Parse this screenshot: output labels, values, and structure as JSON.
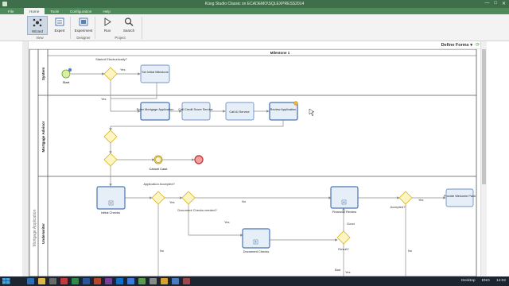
{
  "window": {
    "title": "Kūog Studio Classic on ECADEMO\\SQLEXPRESS2014",
    "minimize": "—",
    "maximize": "□",
    "close": "✕"
  },
  "ribbon_tabs": [
    "File",
    "Home",
    "Tools",
    "Configuration",
    "Help"
  ],
  "ribbon": {
    "buttons": [
      {
        "label": "Wizard",
        "icon": "wizard-icon"
      },
      {
        "label": "Expert",
        "icon": "expert-icon"
      },
      {
        "label": "Experiment",
        "icon": "experiment-icon"
      },
      {
        "label": "Run",
        "icon": "run-icon"
      },
      {
        "label": "Search",
        "icon": "search-icon"
      }
    ],
    "groups": [
      "View",
      "Designer",
      "Project"
    ]
  },
  "header": {
    "define_forms": "Define Forms ▾"
  },
  "diagram": {
    "milestone": "Milestone 1",
    "pool": "Mortgage Application",
    "lanes": [
      "System",
      "Mortgage Advisor",
      "Underwriter"
    ],
    "start": "Start",
    "gateways": {
      "started_electronically": "Started Electronically?",
      "application_accepted": "Application Accepted?",
      "document_checks_needed": "Document Checks needed?",
      "accepted": "Accepted?",
      "result": "Result?"
    },
    "tasks": {
      "set_initial_milestone": "Set Initial Milestone",
      "enter_mortgage_application": "Enter Mortgage Application",
      "call_credit_score": "Call Credit Score Service",
      "call_ai_service": "Call AI Service",
      "review_application": "Review Application",
      "provide_welcome_pack": "Provide Welcome Pack"
    },
    "subprocesses": {
      "initial_checks": "Initial Checks",
      "financial_review": "Financial Review",
      "document_checks": "Document Checks"
    },
    "events": {
      "cancel_case": "Cancel Case"
    },
    "flow_labels": {
      "yes_top": "Yes",
      "yes_left": "Yes",
      "yes_app": "Yes",
      "no_app": "No",
      "yes_docs": "Yes",
      "no_docs": "No",
      "yes_accepted": "Yes",
      "no_accepted": "No",
      "good": "Good",
      "bad": "Bad",
      "yes_bottom": "Yes"
    }
  },
  "taskbar": {
    "desktop": "Desktop",
    "lang": "ENG",
    "time": "14:02"
  },
  "colors": {
    "title_green": "#3f6f4a",
    "tab_green": "#4f8a5b",
    "task_fill": "#e6eef8",
    "task_stroke": "#4a76b4",
    "gateway_fill": "#fff5c2",
    "gateway_stroke": "#d6b21c"
  }
}
